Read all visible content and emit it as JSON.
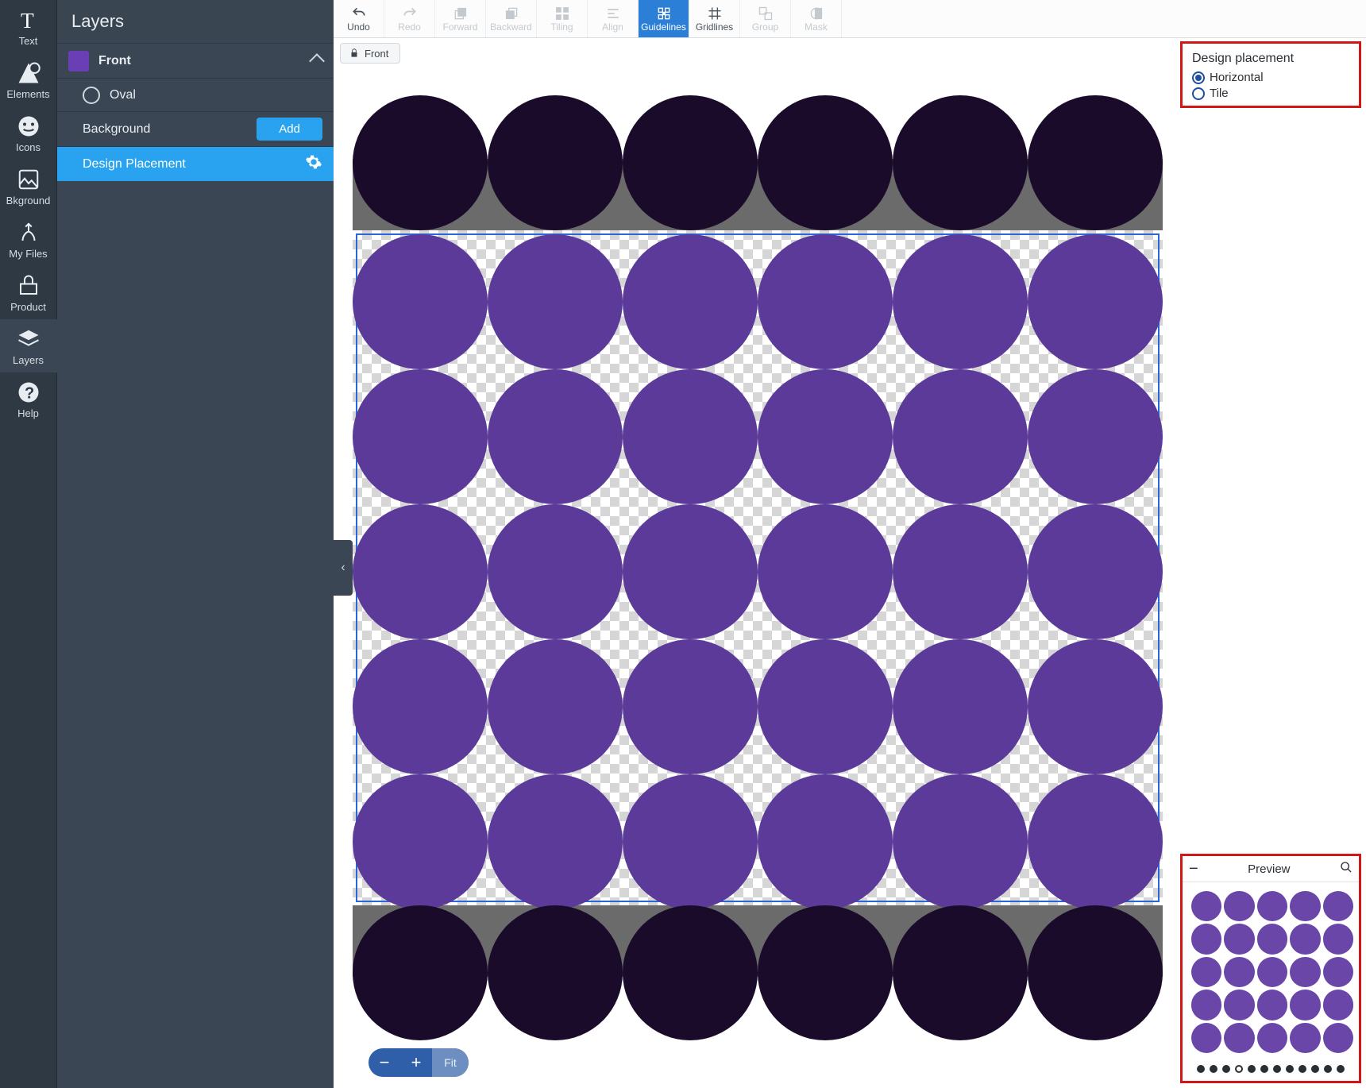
{
  "rail": {
    "items": [
      {
        "label": "Text",
        "name": "text"
      },
      {
        "label": "Elements",
        "name": "elements"
      },
      {
        "label": "Icons",
        "name": "icons"
      },
      {
        "label": "Bkground",
        "name": "background"
      },
      {
        "label": "My Files",
        "name": "my-files"
      },
      {
        "label": "Product",
        "name": "product"
      },
      {
        "label": "Layers",
        "name": "layers"
      },
      {
        "label": "Help",
        "name": "help"
      }
    ],
    "active_index": 6
  },
  "panel": {
    "title": "Layers",
    "front_label": "Front",
    "oval_label": "Oval",
    "background_label": "Background",
    "add_label": "Add",
    "design_placement_label": "Design Placement"
  },
  "toolbar": {
    "items": [
      {
        "label": "Undo",
        "enabled": true
      },
      {
        "label": "Redo",
        "enabled": false
      },
      {
        "label": "Forward",
        "enabled": false
      },
      {
        "label": "Backward",
        "enabled": false
      },
      {
        "label": "Tiling",
        "enabled": false
      },
      {
        "label": "Align",
        "enabled": false
      },
      {
        "label": "Guidelines",
        "enabled": true,
        "active": true
      },
      {
        "label": "Gridlines",
        "enabled": true
      },
      {
        "label": "Group",
        "enabled": false
      },
      {
        "label": "Mask",
        "enabled": false
      }
    ],
    "tab_label": "Front"
  },
  "zoom": {
    "fit_label": "Fit"
  },
  "design_placement": {
    "title": "Design placement",
    "options": [
      {
        "label": "Horizontal",
        "checked": true
      },
      {
        "label": "Tile",
        "checked": false
      }
    ]
  },
  "preview": {
    "title": "Preview",
    "dot_count": 12,
    "hollow_index": 3
  },
  "canvas": {
    "pattern_color": "#5c3a99",
    "bleed_color": "#1b0b2a",
    "cols": 6,
    "rows": 5,
    "diameter": 170,
    "guide_colors": {
      "dash": "#2f9e44",
      "solid": "#2b66d8"
    }
  }
}
